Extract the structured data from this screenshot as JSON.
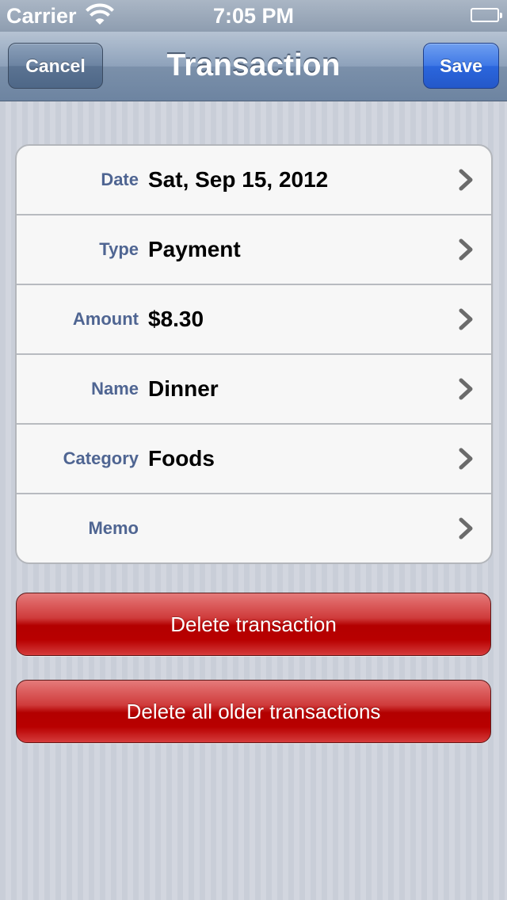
{
  "status_bar": {
    "carrier": "Carrier",
    "time": "7:05 PM"
  },
  "nav": {
    "title": "Transaction",
    "cancel_label": "Cancel",
    "save_label": "Save"
  },
  "fields": [
    {
      "label": "Date",
      "value": "Sat, Sep 15, 2012"
    },
    {
      "label": "Type",
      "value": "Payment"
    },
    {
      "label": "Amount",
      "value": "$8.30"
    },
    {
      "label": "Name",
      "value": "Dinner"
    },
    {
      "label": "Category",
      "value": "Foods"
    },
    {
      "label": "Memo",
      "value": ""
    }
  ],
  "actions": {
    "delete_label": "Delete transaction",
    "delete_older_label": "Delete all older transactions"
  },
  "colors": {
    "label": "#4f6592",
    "save_button": "#2b66dd",
    "destructive": "#b30000"
  }
}
